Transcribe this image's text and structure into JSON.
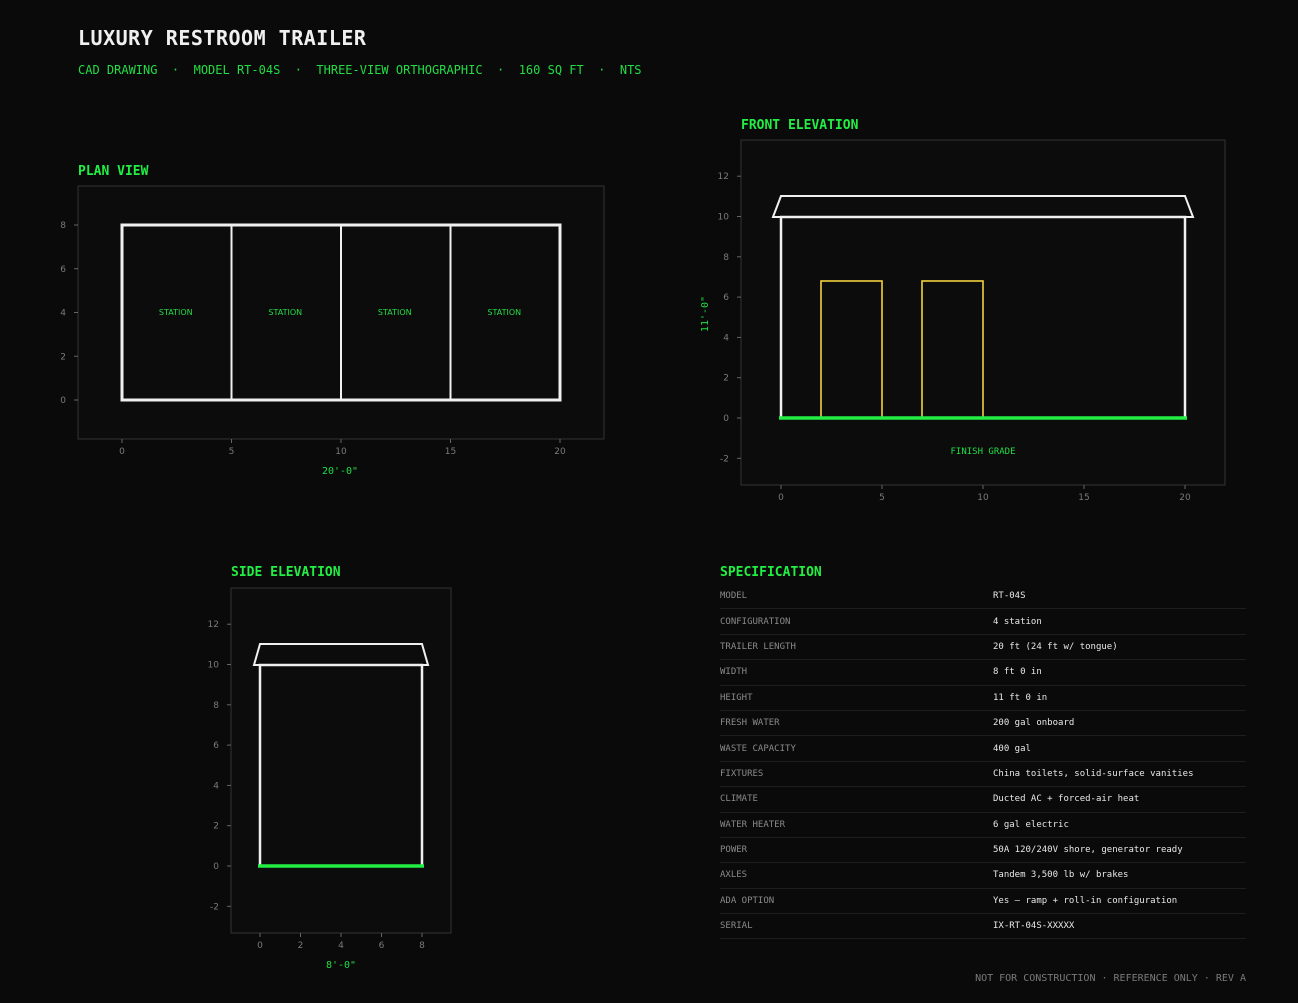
{
  "header": {
    "title": "LUXURY RESTROOM TRAILER",
    "subtitle": "CAD DRAWING  ·  MODEL RT-04S  ·  THREE-VIEW ORTHOGRAPHIC  ·  160 SQ FT  ·  NTS"
  },
  "plan_view": {
    "title": "PLAN VIEW",
    "x_ticks": [
      "0",
      "5",
      "10",
      "15",
      "20"
    ],
    "y_ticks": [
      "0",
      "2",
      "4",
      "6",
      "8"
    ],
    "station_label": "STATION",
    "stations": 4,
    "length_ft": 20,
    "width_ft": 8,
    "dimension_label": "20'-0\""
  },
  "front_elevation": {
    "title": "FRONT ELEVATION",
    "x_ticks": [
      "0",
      "5",
      "10",
      "15",
      "20"
    ],
    "y_ticks": [
      "-2",
      "0",
      "2",
      "4",
      "6",
      "8",
      "10",
      "12"
    ],
    "height_label": "11'-0\"",
    "grade_label": "FINISH GRADE",
    "body_height_ft": 10,
    "roof_height_ft": 11,
    "doors": [
      {
        "x_from": 2,
        "x_to": 5,
        "height": 6.8
      },
      {
        "x_from": 7,
        "x_to": 10,
        "height": 6.8
      }
    ]
  },
  "side_elevation": {
    "title": "SIDE ELEVATION",
    "x_ticks": [
      "0",
      "2",
      "4",
      "6",
      "8"
    ],
    "y_ticks": [
      "-2",
      "0",
      "2",
      "4",
      "6",
      "8",
      "10",
      "12"
    ],
    "width_label": "8'-0\""
  },
  "specification": {
    "title": "SPECIFICATION",
    "rows": [
      {
        "key": "MODEL",
        "value": "RT-04S"
      },
      {
        "key": "CONFIGURATION",
        "value": "4 station"
      },
      {
        "key": "TRAILER LENGTH",
        "value": "20 ft (24 ft w/ tongue)"
      },
      {
        "key": "WIDTH",
        "value": "8 ft 0 in"
      },
      {
        "key": "HEIGHT",
        "value": "11 ft 0 in"
      },
      {
        "key": "FRESH WATER",
        "value": "200 gal onboard"
      },
      {
        "key": "WASTE CAPACITY",
        "value": "400 gal"
      },
      {
        "key": "FIXTURES",
        "value": "China toilets, solid-surface vanities"
      },
      {
        "key": "CLIMATE",
        "value": "Ducted AC + forced-air heat"
      },
      {
        "key": "WATER HEATER",
        "value": "6 gal electric"
      },
      {
        "key": "POWER",
        "value": "50A 120/240V shore, generator ready"
      },
      {
        "key": "AXLES",
        "value": "Tandem 3,500 lb w/ brakes"
      },
      {
        "key": "ADA OPTION",
        "value": "Yes — ramp + roll-in configuration"
      },
      {
        "key": "SERIAL",
        "value": "IX-RT-04S-XXXXX"
      }
    ]
  },
  "footer": "NOT FOR CONSTRUCTION · REFERENCE ONLY · REV A",
  "colors": {
    "background": "#0a0a0a",
    "accent": "#22ee44",
    "outline": "#f0f0f0",
    "door": "#f2d13c",
    "frame": "#333333"
  }
}
